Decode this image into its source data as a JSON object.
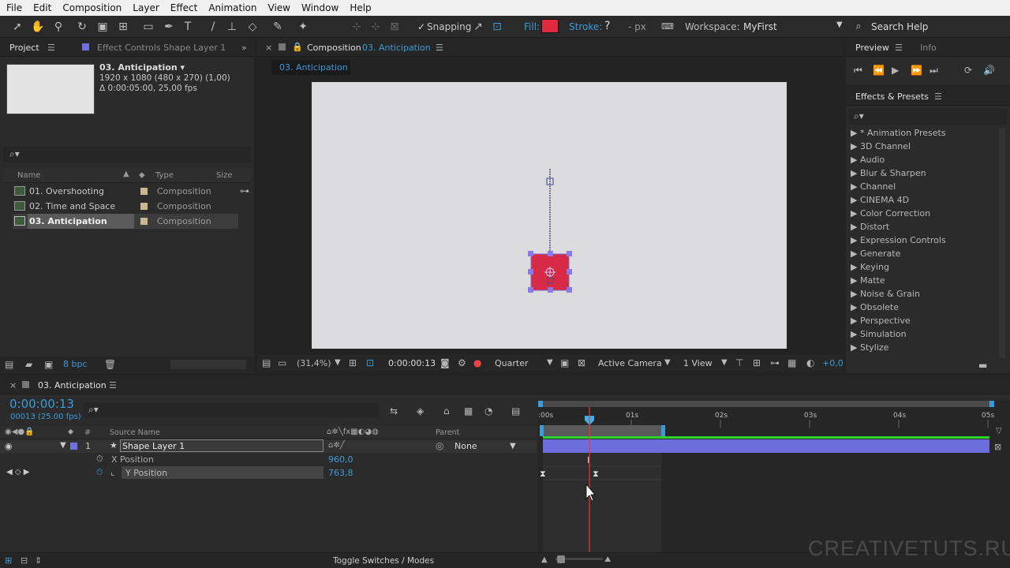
{
  "menu": [
    "File",
    "Edit",
    "Composition",
    "Layer",
    "Effect",
    "Animation",
    "View",
    "Window",
    "Help"
  ],
  "toolbar": {
    "snapping": "Snapping",
    "fill": "Fill:",
    "fill_color": "#e0293f",
    "stroke": "Stroke:",
    "stroke_value": "?",
    "px": "- px",
    "workspace_label": "Workspace:",
    "workspace_value": "MyFirst",
    "search_help": "Search Help"
  },
  "project": {
    "tab": "Project",
    "effect_controls_tab": "Effect Controls Shape Layer 1",
    "comp_name": "03. Anticipation ▾",
    "comp_res": "1920 x 1080  (480 x 270) (1,00)",
    "comp_dur": "Δ 0:00:05:00, 25,00 fps",
    "col_name": "Name",
    "col_type": "Type",
    "col_size": "Size",
    "items": [
      {
        "name": "01. Overshooting",
        "type": "Composition"
      },
      {
        "name": "02. Time and Space",
        "type": "Composition"
      },
      {
        "name": "03. Anticipation",
        "type": "Composition"
      }
    ],
    "bpc": "8 bpc"
  },
  "composition": {
    "tab_prefix": "Composition",
    "tab_name": "03. Anticipation",
    "subtab": "03. Anticipation",
    "zoom": "(31,4%)",
    "timecode": "0:00:00:13",
    "resolution": "Quarter",
    "camera": "Active Camera",
    "views": "1 View",
    "exposure": "+0,0"
  },
  "preview": {
    "tab": "Preview",
    "info_tab": "Info"
  },
  "effects": {
    "tab": "Effects & Presets",
    "items": [
      "* Animation Presets",
      "3D Channel",
      "Audio",
      "Blur & Sharpen",
      "Channel",
      "CINEMA 4D",
      "Color Correction",
      "Distort",
      "Expression Controls",
      "Generate",
      "Keying",
      "Matte",
      "Noise & Grain",
      "Obsolete",
      "Perspective",
      "Simulation",
      "Stylize"
    ]
  },
  "timeline": {
    "tab": "03. Anticipation",
    "timecode": "0:00:00:13",
    "frames": "00013 (25.00 fps)",
    "col_num": "#",
    "col_source": "Source Name",
    "col_parent": "Parent",
    "layer_num": "1",
    "layer_name": "Shape Layer 1",
    "parent_value": "None",
    "props": [
      {
        "name": "X Position",
        "value": "960,0"
      },
      {
        "name": "Y Position",
        "value": "763,8"
      }
    ],
    "ruler": ":00s|01s|02s|03s|04s|05s",
    "toggle": "Toggle Switches / Modes"
  },
  "watermark": "CREATIVETUTS.RU"
}
